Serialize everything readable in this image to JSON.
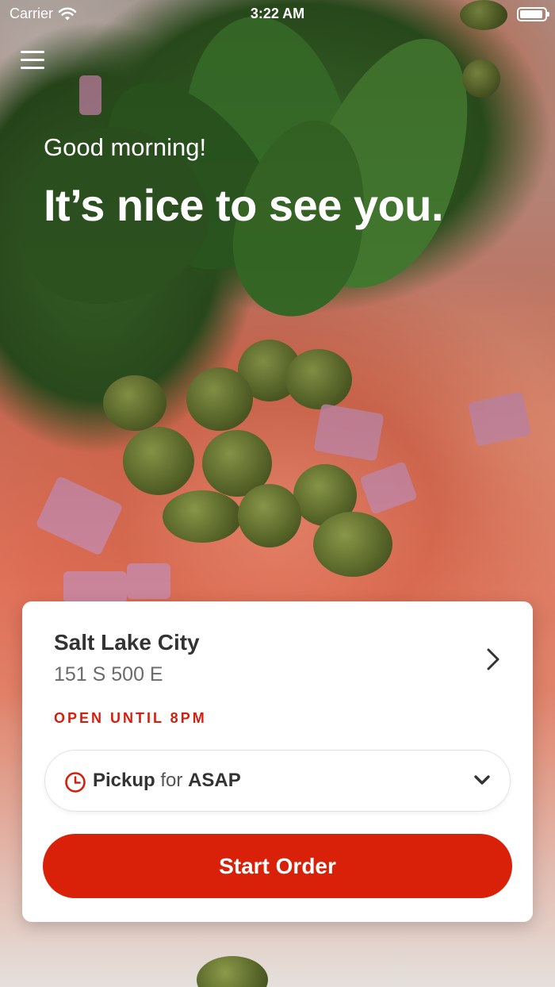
{
  "status_bar": {
    "carrier": "Carrier",
    "time": "3:22 AM"
  },
  "header": {
    "menu_icon": "hamburger-menu-icon",
    "greeting": "Good morning!",
    "headline": "It’s nice to see you."
  },
  "location_card": {
    "name": "Salt Lake City",
    "address": "151 S 500 E",
    "open_status": "OPEN UNTIL 8PM",
    "order_mode": {
      "icon": "clock-icon",
      "mode": "Pickup",
      "connector": "for",
      "time": "ASAP"
    },
    "start_button_label": "Start Order"
  },
  "colors": {
    "brand_red": "#d9210a",
    "status_red": "#d21f0e",
    "text_dark": "#333333",
    "text_muted": "#6b6b6b"
  }
}
